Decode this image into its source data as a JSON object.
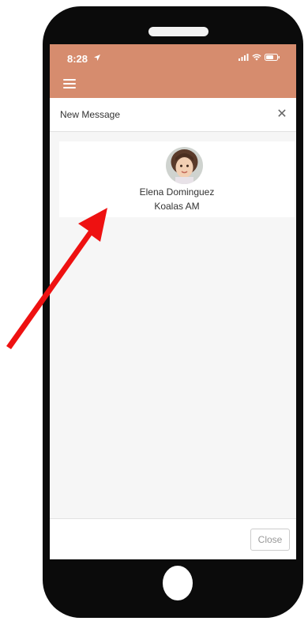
{
  "colors": {
    "app_bar": "#d68c6e",
    "annotation_arrow": "#ee1111",
    "phone_body": "#0b0b0b"
  },
  "status_bar": {
    "time": "8:28",
    "location_icon": "location-arrow-icon",
    "signal_icon": "cellular-signal-icon",
    "wifi_icon": "wifi-icon",
    "battery_icon": "battery-icon"
  },
  "app_bar": {
    "menu_icon": "hamburger-menu-icon"
  },
  "modal": {
    "title": "New Message",
    "close_icon": "close-icon",
    "recipient": {
      "name": "Elena Dominguez",
      "class_name": "Koalas AM",
      "avatar_icon": "child-photo-avatar"
    },
    "footer": {
      "close_label": "Close"
    }
  },
  "annotation": {
    "icon": "red-arrow-annotation"
  }
}
